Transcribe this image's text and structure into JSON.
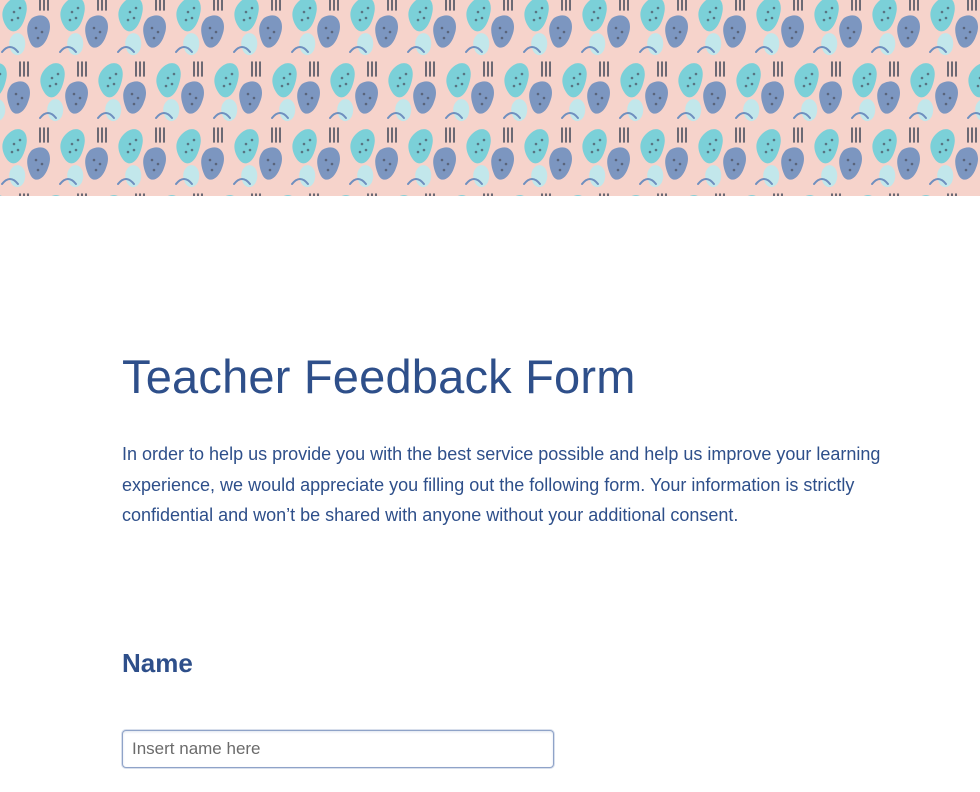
{
  "banner": {
    "colors": {
      "background": "#f6d3cb",
      "teal": "#6ecfd9",
      "blue": "#6f8fbf",
      "light": "#bfe8ec",
      "ink": "#4a4f5e"
    }
  },
  "form": {
    "title": "Teacher Feedback Form",
    "intro": "In order to help us provide you with the best service possible and help us improve your learning experience, we would appreciate you filling out the following form. Your information is strictly confidential and won’t be shared with anyone without your additional consent.",
    "accent_color": "#2e4f8a",
    "name_field": {
      "label": "Name",
      "value": "",
      "placeholder": "Insert name here"
    }
  }
}
